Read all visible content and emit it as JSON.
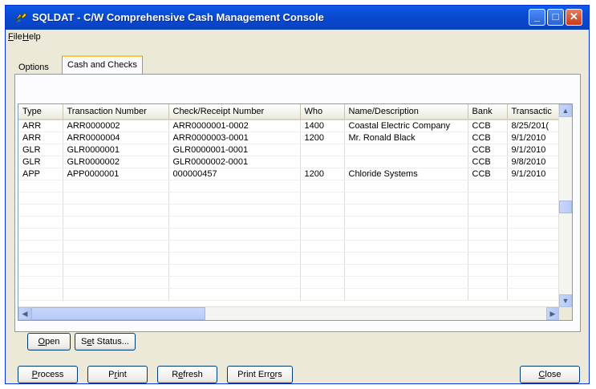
{
  "window": {
    "title": "SQLDAT - C/W Comprehensive Cash Management Console",
    "minimize": "_",
    "maximize": "□",
    "close": "✕"
  },
  "menu": [
    {
      "label_u": "F",
      "label_rest": "ile"
    },
    {
      "label_u": "H",
      "label_rest": "elp"
    }
  ],
  "tabs": {
    "options": "Options",
    "cash_and_checks": "Cash and Checks"
  },
  "grid": {
    "columns": [
      "Type",
      "Transaction Number",
      "Check/Receipt Number",
      "Who",
      "Name/Description",
      "Bank",
      "Transactic"
    ],
    "rows": [
      [
        "ARR",
        "ARR0000002",
        "ARR0000001-0002",
        "1400",
        "Coastal Electric Company",
        "CCB",
        "8/25/201("
      ],
      [
        "ARR",
        "ARR0000004",
        "ARR0000003-0001",
        "1200",
        "Mr. Ronald Black",
        "CCB",
        "9/1/2010"
      ],
      [
        "GLR",
        "GLR0000001",
        "GLR0000001-0001",
        "",
        "",
        "CCB",
        "9/1/2010"
      ],
      [
        "GLR",
        "GLR0000002",
        "GLR0000002-0001",
        "",
        "",
        "CCB",
        "9/8/2010"
      ],
      [
        "APP",
        "APP0000001",
        "000000457",
        "1200",
        "Chloride Systems",
        "CCB",
        "9/1/2010"
      ]
    ]
  },
  "panel_buttons": {
    "open_u": "O",
    "open_rest": "pen",
    "status_pre": "S",
    "status_u": "e",
    "status_rest": "t Status..."
  },
  "footer_buttons": {
    "process_u": "P",
    "process_rest": "rocess",
    "print_pre": "P",
    "print_u": "r",
    "print_rest": "int",
    "refresh_pre": "R",
    "refresh_u": "e",
    "refresh_rest": "fresh",
    "errors_pre": "Print Err",
    "errors_u": "o",
    "errors_rest": "rs",
    "close_u": "C",
    "close_rest": "lose"
  }
}
